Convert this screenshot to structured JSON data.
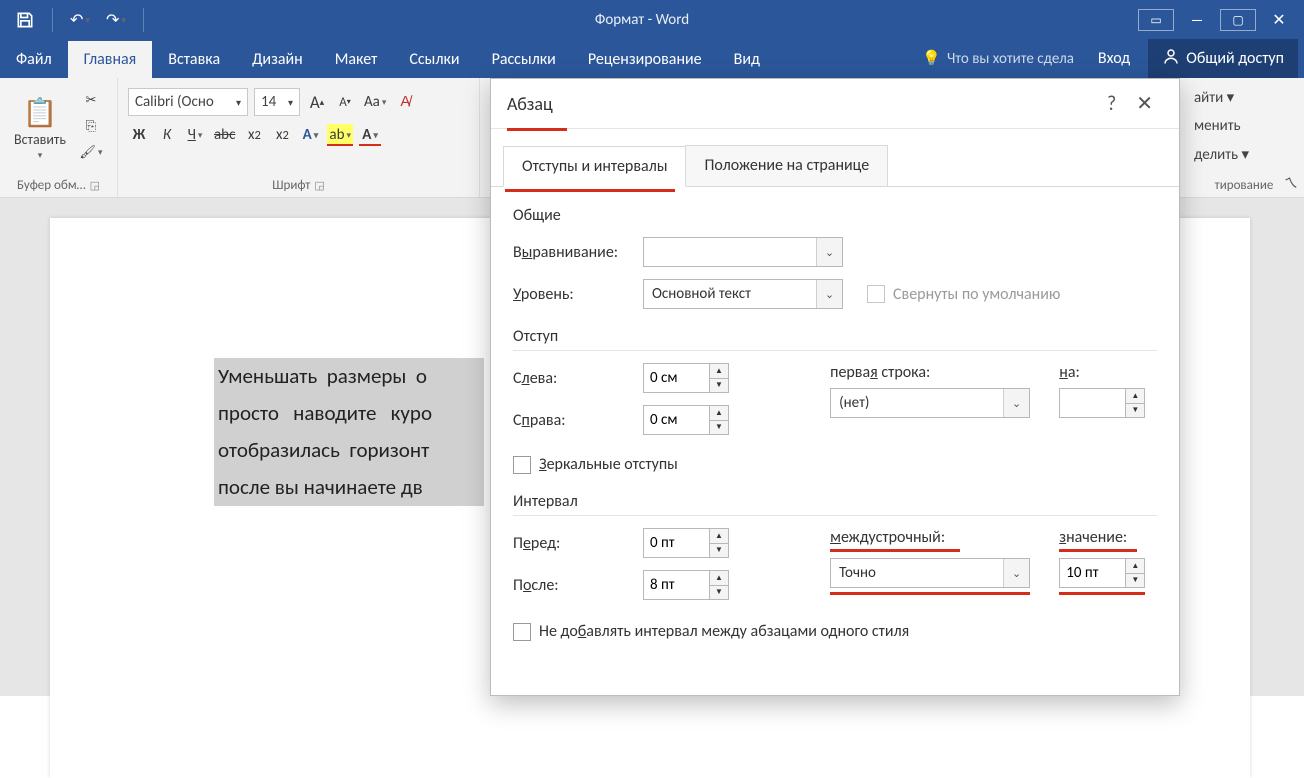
{
  "titlebar": {
    "title": "Формат - Word",
    "login": "Вход",
    "share": "Общий доступ",
    "tell_me": "Что вы хотите сдела"
  },
  "tabs": {
    "file": "Файл",
    "home": "Главная",
    "insert": "Вставка",
    "design": "Дизайн",
    "layout": "Макет",
    "references": "Ссылки",
    "mailings": "Рассылки",
    "review": "Рецензирование",
    "view": "Вид"
  },
  "ribbon": {
    "paste": "Вставить",
    "clipboard_group": "Буфер обм…",
    "font_group": "Шрифт",
    "font_name": "Calibri (Осно",
    "font_size": "14",
    "remnant": {
      "find": "айти ▾",
      "replace": "менить",
      "select": "делить ▾",
      "editing_group": "тирование"
    }
  },
  "document": {
    "line1": "Уменьшать  размеры  о",
    "line2": "просто   наводите   куро",
    "line3": "отобразилась  горизонт",
    "line4": "после вы начинаете дв"
  },
  "dialog": {
    "title": "Абзац",
    "tab1": "Отступы и интервалы",
    "tab2": "Положение на странице",
    "section_general": "Общие",
    "alignment_label": "Выравнивание:",
    "level_label": "Уровень:",
    "level_value": "Основной текст",
    "collapse_default": "Свернуты по умолчанию",
    "section_indent": "Отступ",
    "left_label": "Слева:",
    "left_value": "0 см",
    "right_label": "Справа:",
    "right_value": "0 см",
    "first_line_label": "первая строка:",
    "first_line_value": "(нет)",
    "by_label": "на:",
    "mirror_indents": "Зеркальные отступы",
    "section_spacing": "Интервал",
    "before_label": "Перед:",
    "before_value": "0 пт",
    "after_label": "После:",
    "after_value": "8 пт",
    "line_spacing_label": "междустрочный:",
    "line_spacing_value": "Точно",
    "at_label": "значение:",
    "at_value": "10 пт",
    "dont_add_space": "Не добавлять интервал между абзацами одного стиля"
  }
}
